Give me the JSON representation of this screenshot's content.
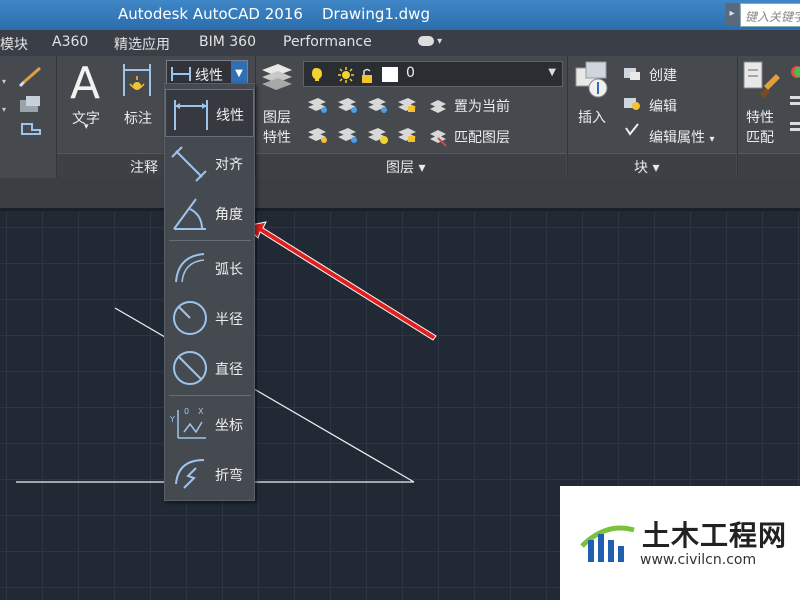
{
  "titlebar": {
    "title": "Autodesk AutoCAD 2016    Drawing1.dwg",
    "search_placeholder": "键入关键字"
  },
  "tabs": [
    "模块",
    "A360",
    "精选应用",
    "BIM 360",
    "Performance"
  ],
  "ribbon": {
    "annotation": {
      "text_label": "文字",
      "dim_label": "标注",
      "linear_dropdown_label": "线性",
      "footer": "注释"
    },
    "layers": {
      "layer_properties_line1": "图层",
      "layer_properties_line2": "特性",
      "current_layer_value": "0",
      "set_current_label": "置为当前",
      "match_layer_label": "匹配图层",
      "footer": "图层"
    },
    "block": {
      "insert_label": "插入",
      "create_label": "创建",
      "edit_label": "编辑",
      "edit_attributes_label": "编辑属性",
      "footer": "块"
    },
    "properties": {
      "match_line1": "特性",
      "match_line2": "匹配"
    }
  },
  "dimension_menu": {
    "items": [
      {
        "label": "线性",
        "icon": "linear-dim-icon",
        "selected": true
      },
      {
        "label": "对齐",
        "icon": "aligned-dim-icon"
      },
      {
        "label": "角度",
        "icon": "angular-dim-icon"
      },
      {
        "label": "弧长",
        "icon": "arc-length-dim-icon"
      },
      {
        "label": "半径",
        "icon": "radius-dim-icon"
      },
      {
        "label": "直径",
        "icon": "diameter-dim-icon"
      },
      {
        "label": "坐标",
        "icon": "ordinate-dim-icon"
      },
      {
        "label": "折弯",
        "icon": "jogged-dim-icon"
      }
    ]
  },
  "watermark": {
    "brand": "土木工程网",
    "url": "www.civilcn.com"
  },
  "colors": {
    "accent_blue": "#2f6fb3",
    "arrow_red": "#e02020",
    "canvas": "#212935"
  }
}
